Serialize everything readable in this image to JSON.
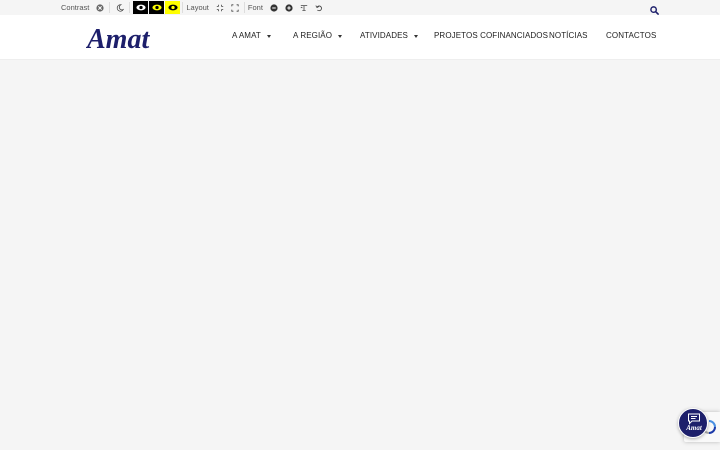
{
  "accessibility": {
    "contrast_label": "Contrast",
    "layout_label": "Layout",
    "font_label": "Font"
  },
  "header": {
    "logo_text": "Amat",
    "nav": [
      {
        "label": "A AMAT",
        "has_dropdown": true
      },
      {
        "label": "A REGIÃO",
        "has_dropdown": true
      },
      {
        "label": "ATIVIDADES",
        "has_dropdown": true
      },
      {
        "label": "PROJETOS COFINANCIADOS",
        "has_dropdown": false
      },
      {
        "label": "NOTÍCIAS",
        "has_dropdown": false
      },
      {
        "label": "CONTACTOS",
        "has_dropdown": false
      }
    ]
  },
  "chat": {
    "label": "Amat"
  },
  "colors": {
    "brand": "#1d1f6b",
    "background": "#f5f5f5",
    "contrast_yellow": "#ffff00"
  }
}
